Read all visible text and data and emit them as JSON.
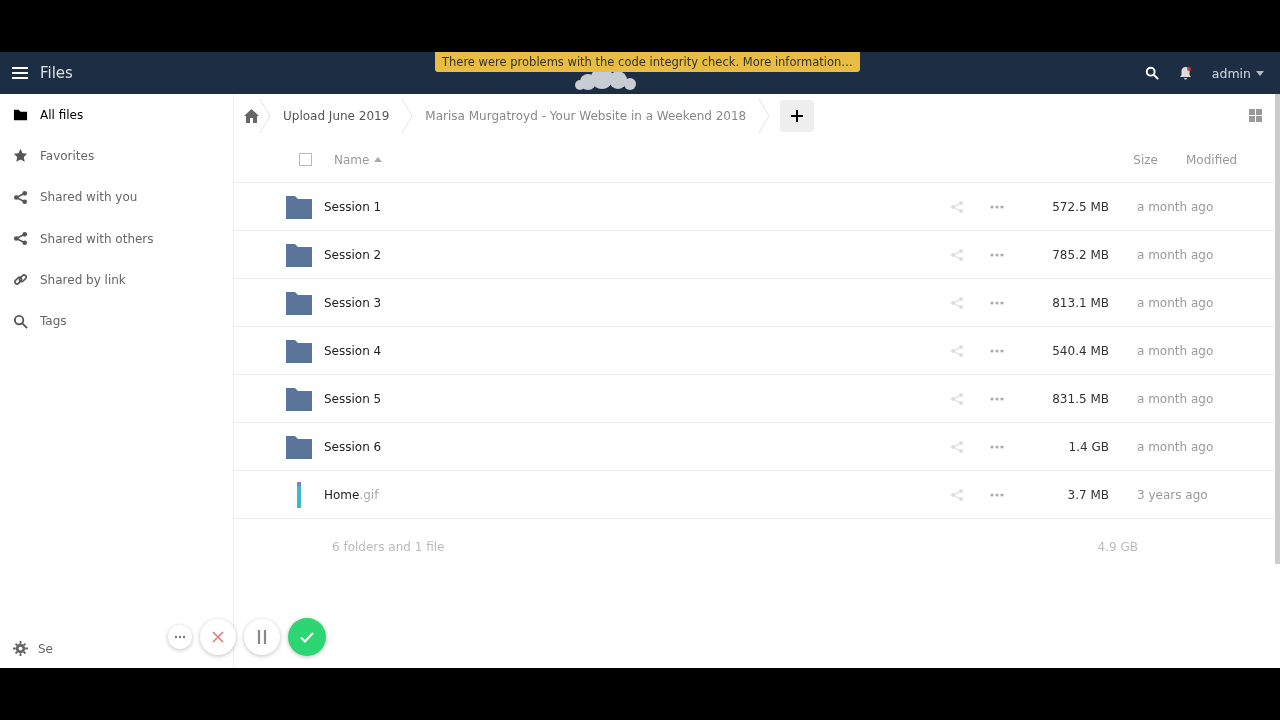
{
  "header": {
    "title": "Files",
    "notice": "There were problems with the code integrity check. More information…",
    "user": "admin"
  },
  "sidebar": {
    "items": [
      {
        "label": "All files",
        "selected": true
      },
      {
        "label": "Favorites",
        "selected": false
      },
      {
        "label": "Shared with you",
        "selected": false
      },
      {
        "label": "Shared with others",
        "selected": false
      },
      {
        "label": "Shared by link",
        "selected": false
      },
      {
        "label": "Tags",
        "selected": false
      }
    ],
    "settings": "Se"
  },
  "breadcrumbs": [
    "Upload June 2019",
    "Marisa Murgatroyd - Your Website in a Weekend 2018"
  ],
  "table": {
    "select_all": {
      "checked": false
    },
    "columns": {
      "name": "Name",
      "size": "Size",
      "modified": "Modified"
    },
    "rows": [
      {
        "kind": "folder",
        "name": "Session 1",
        "size": "572.5 MB",
        "modified": "a month ago"
      },
      {
        "kind": "folder",
        "name": "Session 2",
        "size": "785.2 MB",
        "modified": "a month ago"
      },
      {
        "kind": "folder",
        "name": "Session 3",
        "size": "813.1 MB",
        "modified": "a month ago"
      },
      {
        "kind": "folder",
        "name": "Session 4",
        "size": "540.4 MB",
        "modified": "a month ago"
      },
      {
        "kind": "folder",
        "name": "Session 5",
        "size": "831.5 MB",
        "modified": "a month ago"
      },
      {
        "kind": "folder",
        "name": "Session 6",
        "size": "1.4 GB",
        "modified": "a month ago"
      },
      {
        "kind": "file",
        "name": "Home",
        "extension": ".gif",
        "size": "3.7 MB",
        "modified": "3 years ago"
      }
    ],
    "summary": {
      "text": "6 folders and 1 file",
      "size": "4.9 GB"
    }
  }
}
